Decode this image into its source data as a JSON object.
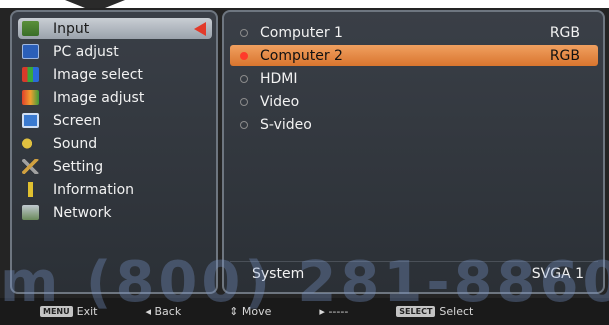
{
  "left_menu": {
    "items": [
      {
        "label": "Input",
        "icon": "input-icon",
        "active": true
      },
      {
        "label": "PC adjust",
        "icon": "monitor-icon",
        "active": false
      },
      {
        "label": "Image select",
        "icon": "image-select-icon",
        "active": false
      },
      {
        "label": "Image adjust",
        "icon": "image-adjust-icon",
        "active": false
      },
      {
        "label": "Screen",
        "icon": "screen-icon",
        "active": false
      },
      {
        "label": "Sound",
        "icon": "speaker-icon",
        "active": false
      },
      {
        "label": "Setting",
        "icon": "tools-icon",
        "active": false
      },
      {
        "label": "Information",
        "icon": "info-icon",
        "active": false
      },
      {
        "label": "Network",
        "icon": "network-icon",
        "active": false
      }
    ]
  },
  "input_list": {
    "rows": [
      {
        "label": "Computer 1",
        "signal": "RGB",
        "selected": false
      },
      {
        "label": "Computer 2",
        "signal": "RGB",
        "selected": true
      },
      {
        "label": "HDMI",
        "signal": "",
        "selected": false
      },
      {
        "label": "Video",
        "signal": "",
        "selected": false
      },
      {
        "label": "S-video",
        "signal": "",
        "selected": false
      }
    ],
    "system_label": "System",
    "system_value": "SVGA 1"
  },
  "footer": {
    "exit_key": "MENU",
    "exit_label": "Exit",
    "back_label": "◂ Back",
    "move_label": "⇕ Move",
    "next_label": "▸ -----",
    "select_key": "SELECT",
    "select_label": "Select"
  },
  "watermark": "m (800) 281-8860",
  "colors": {
    "accent_selected": "#e0813c",
    "active_arrow": "#e23a2a",
    "panel_border": "#6e7680"
  }
}
